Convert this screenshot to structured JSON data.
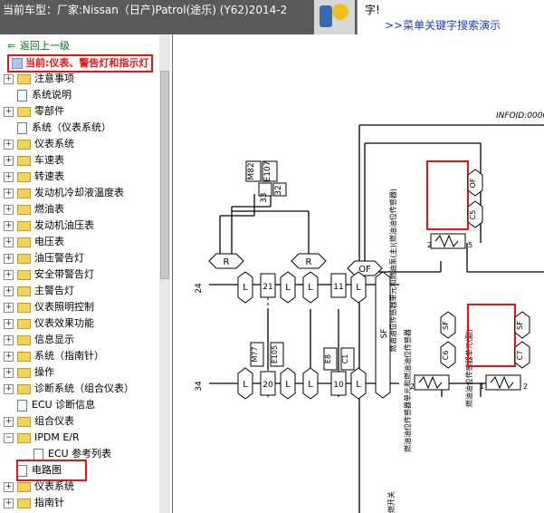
{
  "window": {
    "title": "当前车型：厂家:Nissan（日产)Patrol(途乐) (Y62)2014-2",
    "search_char": "字!",
    "search_link": ">>菜单关键字搜索演示"
  },
  "sidebar": {
    "back_label": "返回上一级",
    "current_label": "当前:仪表、警告灯和指示灯",
    "items": [
      {
        "label": "注意事项"
      },
      {
        "label": "系统说明"
      },
      {
        "label": "零部件"
      },
      {
        "label": "系统（仪表系统）"
      },
      {
        "label": "仪表系统"
      },
      {
        "label": "车速表"
      },
      {
        "label": "转速表"
      },
      {
        "label": "发动机冷却液温度表"
      },
      {
        "label": "燃油表"
      },
      {
        "label": "发动机油压表"
      },
      {
        "label": "电压表"
      },
      {
        "label": "油压警告灯"
      },
      {
        "label": "安全带警告灯"
      },
      {
        "label": "主警告灯"
      },
      {
        "label": "仪表照明控制"
      },
      {
        "label": "仪表效果功能"
      },
      {
        "label": "信息显示"
      },
      {
        "label": "系统（指南针）"
      },
      {
        "label": "操作"
      },
      {
        "label": "诊断系统（组合仪表）"
      },
      {
        "label": "ECU 诊断信息"
      },
      {
        "label": "组合仪表"
      },
      {
        "label": "IPDM E/R"
      },
      {
        "label": "ECU 参考列表"
      },
      {
        "label": "电路图"
      },
      {
        "label": "仪表系统"
      },
      {
        "label": "指南针"
      }
    ]
  },
  "diagram": {
    "infoid": "INFOID:0000",
    "conn_m82": "M82",
    "conn_e107": "E107",
    "pin_33": "33",
    "pin_32": "32",
    "r_left": "R",
    "r_right": "R",
    "of_label": "OF",
    "l_label": "L",
    "pin_21": "21",
    "pin_11": "11",
    "sf_label": "SF",
    "m77": "M77",
    "e105": "E105",
    "pin_20": "20",
    "e8": "E8",
    "c1": "C1",
    "pin_10": "10",
    "ref_24": "24",
    "ref_34": "34",
    "sender_main": "燃油油位传感器单元和燃油泵(主)(燃油油位传感器)",
    "sender_main_of": "OF",
    "sender_main_c5": "C5",
    "sender_sub": "燃油油位传感器单元(副)",
    "sender_left": "燃油油位传感器单元和燃油油位传感器",
    "sf_small_1": "SF",
    "sf_small_2": "SF",
    "c6": "C6",
    "c7": "C7",
    "pin_2a": "2",
    "pin_5": "5",
    "pin_2b": "2",
    "pin_1": "1",
    "pin_2c": "2",
    "bottom_text": "燃开关"
  }
}
